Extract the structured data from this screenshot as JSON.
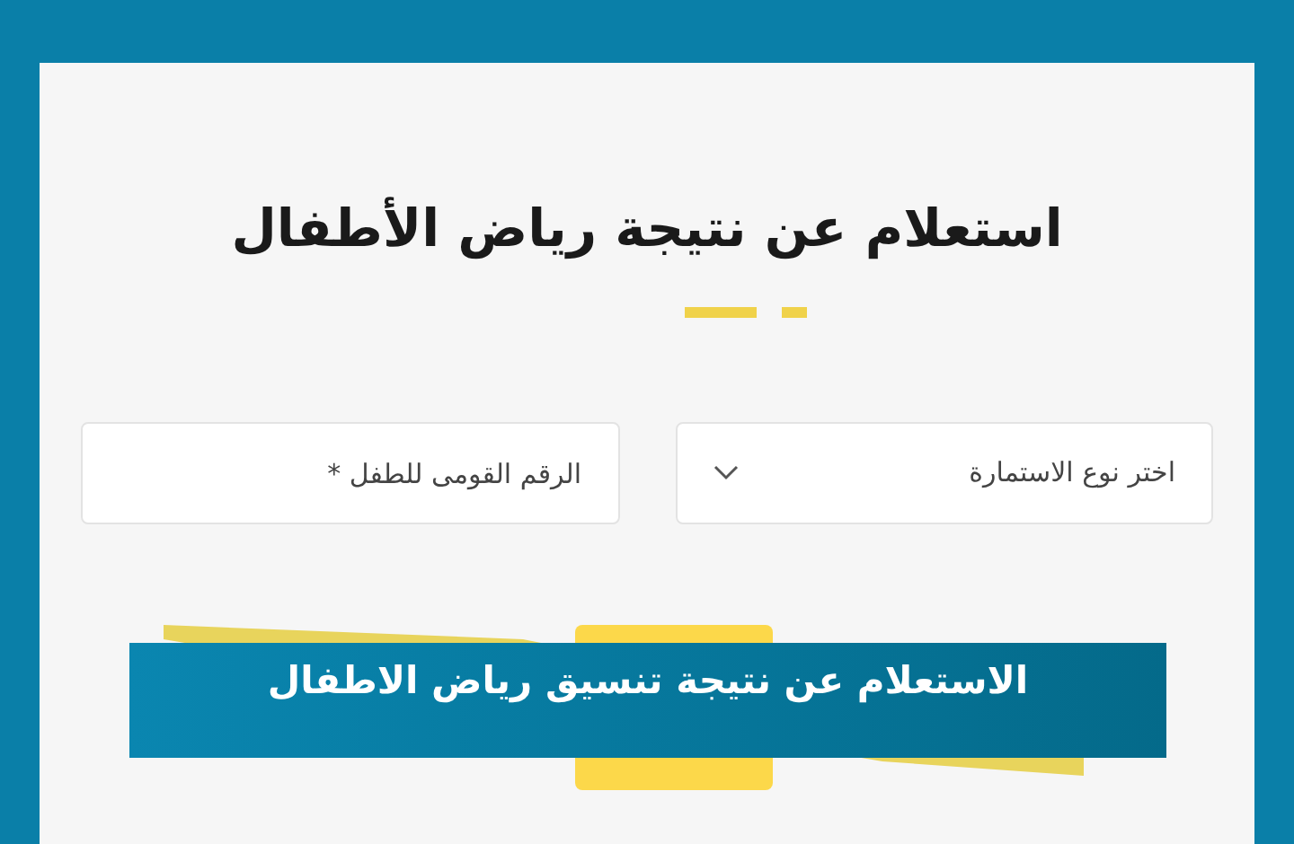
{
  "form": {
    "title": "استعلام عن نتيجة رياض الأطفال",
    "fields": [
      {
        "kind": "select",
        "placeholder": "اختر نوع الاستمارة"
      },
      {
        "kind": "text",
        "placeholder": "الرقم القومى للطفل *"
      }
    ]
  },
  "caption": {
    "text": "الاستعلام عن نتيجة تنسيق رياض الاطفال"
  }
}
